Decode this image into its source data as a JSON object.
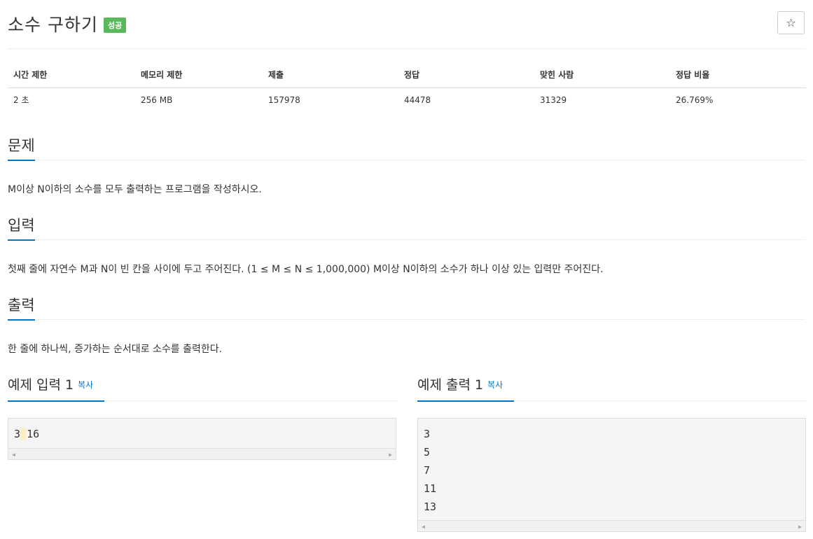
{
  "problem": {
    "title": "소수 구하기",
    "status": "성공",
    "star_icon": "☆"
  },
  "info": {
    "headers": [
      "시간 제한",
      "메모리 제한",
      "제출",
      "정답",
      "맞힌 사람",
      "정답 비율"
    ],
    "values": [
      "2 초",
      "256 MB",
      "157978",
      "44478",
      "31329",
      "26.769%"
    ]
  },
  "sections": {
    "description": {
      "title": "문제",
      "text": "M이상 N이하의 소수를 모두 출력하는 프로그램을 작성하시오."
    },
    "input": {
      "title": "입력",
      "text": "첫째 줄에 자연수 M과 N이 빈 칸을 사이에 두고 주어진다. (1 ≤ M ≤ N ≤ 1,000,000) M이상 N이하의 소수가 하나 이상 있는 입력만 주어진다."
    },
    "output": {
      "title": "출력",
      "text": "한 줄에 하나씩, 증가하는 순서대로 소수를 출력한다."
    }
  },
  "samples": {
    "input": {
      "title": "예제 입력 1",
      "copy": "복사",
      "parts": [
        "3",
        " ",
        "16"
      ]
    },
    "output": {
      "title": "예제 출력 1",
      "copy": "복사",
      "lines": [
        "3",
        "5",
        "7",
        "11",
        "13"
      ]
    }
  },
  "scroll_arrows": {
    "left": "◀",
    "right": "▶"
  }
}
